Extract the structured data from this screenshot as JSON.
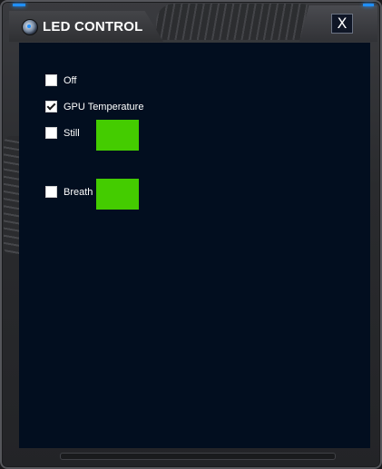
{
  "window": {
    "title": "LED CONTROL",
    "close_label": "X",
    "accent_color": "#1f8fff",
    "background_color": "#020e1f"
  },
  "icons": {
    "logo": "logo-icon",
    "close": "close-icon",
    "check": "check-icon"
  },
  "options": [
    {
      "label": "Off",
      "checked": false
    },
    {
      "label": "GPU Temperature",
      "checked": true
    },
    {
      "label": "Still",
      "checked": false,
      "color": "#44cc00"
    },
    {
      "label": "Breath",
      "checked": false,
      "color": "#44cc00"
    }
  ]
}
